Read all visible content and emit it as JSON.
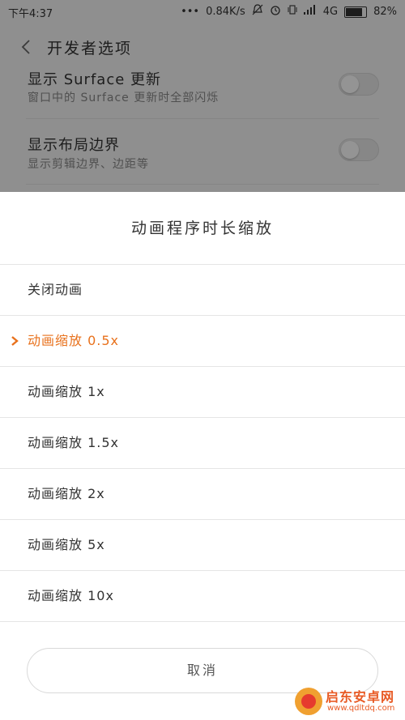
{
  "status_bar": {
    "time": "下午4:37",
    "network_speed": "0.84K/s",
    "network_type": "4G",
    "battery": "82%",
    "icons": [
      "dots-icon",
      "mute-icon",
      "alarm-icon",
      "vibrate-icon",
      "signal-icon",
      "battery-icon"
    ]
  },
  "header": {
    "title": "开发者选项",
    "back_icon": "chevron-left-icon"
  },
  "settings": [
    {
      "title": "显示 Surface 更新",
      "subtitle": "窗口中的 Surface 更新时全部闪烁",
      "toggle": "off"
    },
    {
      "title": "显示布局边界",
      "subtitle": "显示剪辑边界、边距等",
      "toggle": "off"
    }
  ],
  "dialog": {
    "title": "动画程序时长缩放",
    "options": [
      {
        "label": "关闭动画",
        "selected": false
      },
      {
        "label": "动画缩放 0.5x",
        "selected": true
      },
      {
        "label": "动画缩放 1x",
        "selected": false
      },
      {
        "label": "动画缩放 1.5x",
        "selected": false
      },
      {
        "label": "动画缩放 2x",
        "selected": false
      },
      {
        "label": "动画缩放 5x",
        "selected": false
      },
      {
        "label": "动画缩放 10x",
        "selected": false
      }
    ],
    "cancel_label": "取消"
  },
  "colors": {
    "accent": "#e8711c",
    "dim_overlay": "rgba(0,0,0,0.42)"
  },
  "watermark": {
    "name": "启东安卓网",
    "url": "www.qdltdq.com"
  }
}
